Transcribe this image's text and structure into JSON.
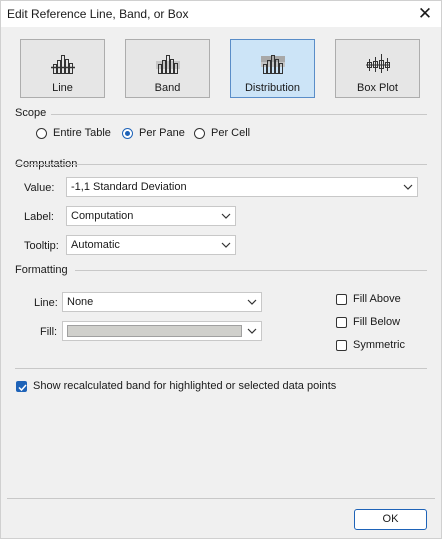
{
  "window": {
    "title": "Edit Reference Line, Band, or Box",
    "close_glyph": "✕"
  },
  "type_buttons": [
    {
      "label": "Line",
      "icon": "line-chart-icon",
      "selected": false
    },
    {
      "label": "Band",
      "icon": "band-chart-icon",
      "selected": false
    },
    {
      "label": "Distribution",
      "icon": "distribution-chart-icon",
      "selected": true
    },
    {
      "label": "Box Plot",
      "icon": "box-plot-icon",
      "selected": false
    }
  ],
  "scope": {
    "heading": "Scope",
    "options": [
      {
        "label": "Entire Table",
        "checked": false
      },
      {
        "label": "Per Pane",
        "checked": true
      },
      {
        "label": "Per Cell",
        "checked": false
      }
    ]
  },
  "computation": {
    "heading": "Computation",
    "value_label": "Value:",
    "value": "-1,1 Standard Deviation",
    "label_label": "Label:",
    "label_value": "Computation",
    "tooltip_label": "Tooltip:",
    "tooltip_value": "Automatic"
  },
  "formatting": {
    "heading": "Formatting",
    "line_label": "Line:",
    "line_value": "None",
    "fill_label": "Fill:",
    "fill_color": "#d0d0cc",
    "fill_above": {
      "label": "Fill Above",
      "checked": false
    },
    "fill_below": {
      "label": "Fill Below",
      "checked": false
    },
    "symmetric": {
      "label": "Symmetric",
      "checked": false
    }
  },
  "recalc": {
    "label": "Show recalculated band for highlighted or selected data points",
    "checked": true
  },
  "footer": {
    "ok_label": "OK"
  },
  "colors": {
    "accent": "#1e63b8",
    "selected_bg": "#cce4f7",
    "dialog_bg": "#f0f0f0"
  }
}
